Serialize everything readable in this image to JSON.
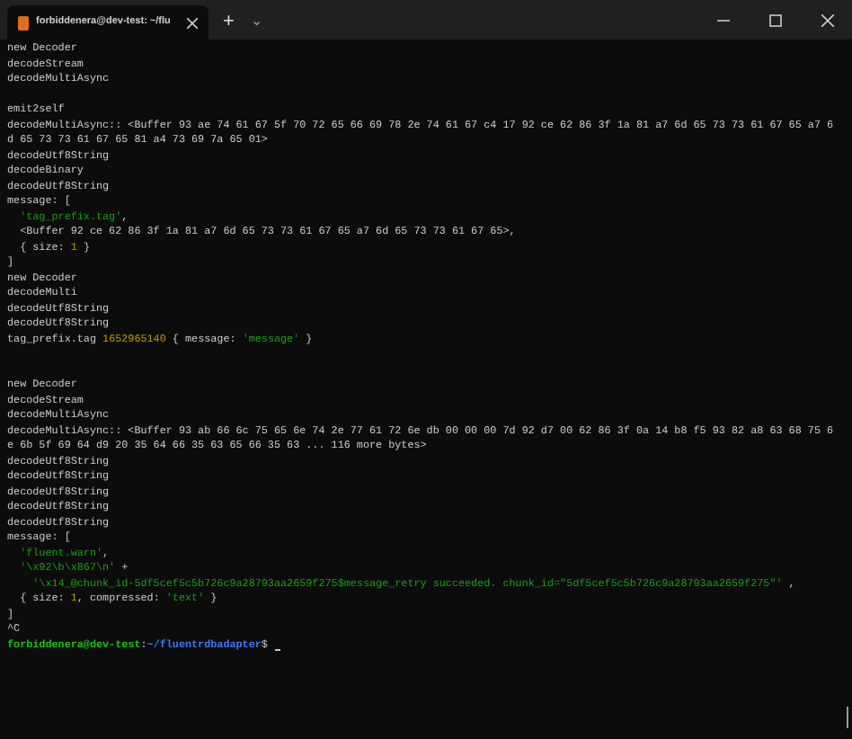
{
  "window": {
    "tabs": [
      {
        "title": "forbiddenera@dev-test: ~/flu",
        "selected": true
      }
    ],
    "new_tab": "+",
    "dropdown": "⌄"
  },
  "terminal": {
    "lines": [
      {
        "segments": [
          {
            "text": "new Decoder",
            "kind": "plain"
          }
        ]
      },
      {
        "segments": [
          {
            "text": "decodeStream",
            "kind": "plain"
          }
        ]
      },
      {
        "segments": [
          {
            "text": "decodeMultiAsync",
            "kind": "plain"
          }
        ]
      },
      {
        "kind": "blank"
      },
      {
        "segments": [
          {
            "text": "emit2self",
            "kind": "plain"
          }
        ]
      },
      {
        "segments": [
          {
            "text": "decodeMultiAsync:: <Buffer 93 ae 74 61 67 5f 70 72 65 66 69 78 2e 74 61 67 c4 17 92 ce 62 86 3f 1a 81 a7 6d 65 73 73 61 67 65 a7 6",
            "kind": "plain"
          }
        ]
      },
      {
        "segments": [
          {
            "text": "d 65 73 73 61 67 65 81 a4 73 69 7a 65 01>",
            "kind": "plain"
          }
        ]
      },
      {
        "segments": [
          {
            "text": "decodeUtf8String",
            "kind": "plain"
          }
        ]
      },
      {
        "segments": [
          {
            "text": "decodeBinary",
            "kind": "plain"
          }
        ]
      },
      {
        "segments": [
          {
            "text": "decodeUtf8String",
            "kind": "plain"
          }
        ]
      },
      {
        "segments": [
          {
            "text": "message: [",
            "kind": "plain"
          }
        ]
      },
      {
        "segments": [
          {
            "text": "  'tag_prefix.tag'",
            "kind": "string"
          },
          {
            "text": ",",
            "kind": "plain"
          }
        ]
      },
      {
        "segments": [
          {
            "text": "  <Buffer 92 ce 62 86 3f 1a 81 a7 6d 65 73 73 61 67 65 a7 6d 65 73 73 61 67 65>,",
            "kind": "plain"
          }
        ]
      },
      {
        "segments": [
          {
            "text": "  { size: ",
            "kind": "plain"
          },
          {
            "text": "1",
            "kind": "number"
          },
          {
            "text": " }",
            "kind": "plain"
          }
        ]
      },
      {
        "segments": [
          {
            "text": "]",
            "kind": "plain"
          }
        ]
      },
      {
        "segments": [
          {
            "text": "new Decoder",
            "kind": "plain"
          }
        ]
      },
      {
        "segments": [
          {
            "text": "decodeMulti",
            "kind": "plain"
          }
        ]
      },
      {
        "segments": [
          {
            "text": "decodeUtf8String",
            "kind": "plain"
          }
        ]
      },
      {
        "segments": [
          {
            "text": "decodeUtf8String",
            "kind": "plain"
          }
        ]
      },
      {
        "segments": [
          {
            "text": "tag_prefix.tag ",
            "kind": "plain"
          },
          {
            "text": "1652965140",
            "kind": "number"
          },
          {
            "text": " { message: ",
            "kind": "plain"
          },
          {
            "text": "'message'",
            "kind": "string"
          },
          {
            "text": " }",
            "kind": "plain"
          }
        ]
      },
      {
        "kind": "blank"
      },
      {
        "kind": "blank"
      },
      {
        "segments": [
          {
            "text": "new Decoder",
            "kind": "plain"
          }
        ]
      },
      {
        "segments": [
          {
            "text": "decodeStream",
            "kind": "plain"
          }
        ]
      },
      {
        "segments": [
          {
            "text": "decodeMultiAsync",
            "kind": "plain"
          }
        ]
      },
      {
        "segments": [
          {
            "text": "decodeMultiAsync:: <Buffer 93 ab 66 6c 75 65 6e 74 2e 77 61 72 6e db 00 00 00 7d 92 d7 00 62 86 3f 0a 14 b8 f5 93 82 a8 63 68 75 6",
            "kind": "plain"
          }
        ]
      },
      {
        "segments": [
          {
            "text": "e 6b 5f 69 64 d9 20 35 64 66 35 63 65 66 35 63 ... 116 more bytes>",
            "kind": "plain"
          }
        ]
      },
      {
        "segments": [
          {
            "text": "decodeUtf8String",
            "kind": "plain"
          }
        ]
      },
      {
        "segments": [
          {
            "text": "decodeUtf8String",
            "kind": "plain"
          }
        ]
      },
      {
        "segments": [
          {
            "text": "decodeUtf8String",
            "kind": "plain"
          }
        ]
      },
      {
        "segments": [
          {
            "text": "decodeUtf8String",
            "kind": "plain"
          }
        ]
      },
      {
        "segments": [
          {
            "text": "decodeUtf8String",
            "kind": "plain"
          }
        ]
      },
      {
        "segments": [
          {
            "text": "message: [",
            "kind": "plain"
          }
        ]
      },
      {
        "segments": [
          {
            "text": "  'fluent.warn'",
            "kind": "string"
          },
          {
            "text": ",",
            "kind": "plain"
          }
        ]
      },
      {
        "segments": [
          {
            "text": "  '\\x92\\b\\x867\\n'",
            "kind": "string"
          },
          {
            "text": " +",
            "kind": "plain"
          }
        ]
      },
      {
        "segments": [
          {
            "text": "    '\\x14_@chunk_id-5df5cef5c5b726c9a28793aa2659f275$message_retry succeeded. chunk_id=\"5df5cef5c5b726c9a28793aa2659f275\"'",
            "kind": "string"
          },
          {
            "text": " ,",
            "kind": "plain"
          }
        ]
      },
      {
        "segments": [
          {
            "text": "  { size: ",
            "kind": "plain"
          },
          {
            "text": "1",
            "kind": "number"
          },
          {
            "text": ", compressed: ",
            "kind": "plain"
          },
          {
            "text": "'text'",
            "kind": "string"
          },
          {
            "text": " }",
            "kind": "plain"
          }
        ]
      },
      {
        "segments": [
          {
            "text": "]",
            "kind": "plain"
          }
        ]
      },
      {
        "segments": [
          {
            "text": "^C",
            "kind": "plain"
          }
        ]
      },
      {
        "segments": [
          {
            "text": "forbiddenera@dev-test",
            "kind": "user"
          },
          {
            "text": ":",
            "kind": "plain"
          },
          {
            "text": "~/fluentrdbadapter",
            "kind": "path"
          },
          {
            "text": "$ ",
            "kind": "plain"
          }
        ],
        "cursor": true
      }
    ]
  }
}
